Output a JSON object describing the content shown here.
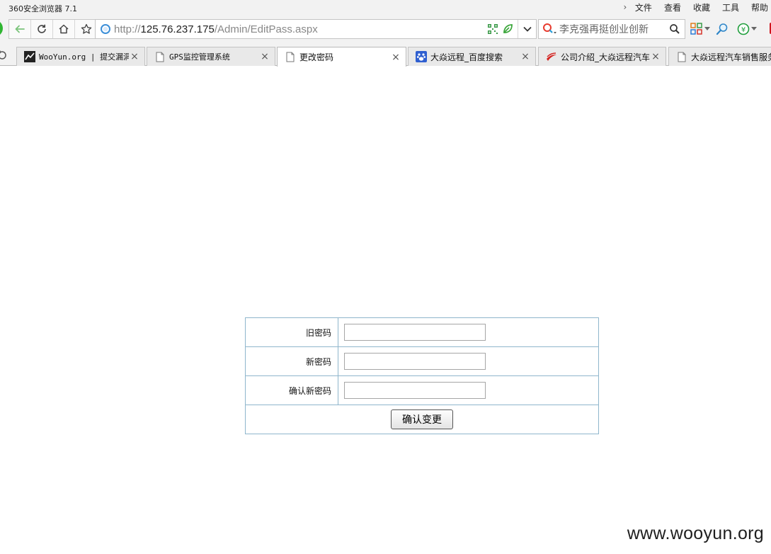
{
  "browser": {
    "title": "360安全浏览器 7.1",
    "menu": [
      "文件",
      "查看",
      "收藏",
      "工具",
      "帮助"
    ]
  },
  "address": {
    "scheme": "http://",
    "host": "125.76.237.175",
    "path": "/Admin/EditPass.aspx"
  },
  "search": {
    "query": "李克强再挺创业创新"
  },
  "tabs": [
    {
      "title": "WooYun.org | 提交漏洞",
      "icon": "wooyun-icon",
      "active": false
    },
    {
      "title": "GPS监控管理系统",
      "icon": "page-icon",
      "active": false
    },
    {
      "title": "更改密码",
      "icon": "page-icon",
      "active": true
    },
    {
      "title": "大焱远程_百度搜索",
      "icon": "baidu-paw-icon",
      "active": false
    },
    {
      "title": "公司介绍_大焱远程汽车",
      "icon": "brand-swoosh-icon",
      "active": false
    },
    {
      "title": "大焱远程汽车销售服务",
      "icon": "page-icon",
      "active": false
    }
  ],
  "form": {
    "old_password_label": "旧密码",
    "new_password_label": "新密码",
    "confirm_password_label": "确认新密码",
    "old_password_value": "",
    "new_password_value": "",
    "confirm_password_value": "",
    "submit_label": "确认变更"
  },
  "watermark": "www.wooyun.org",
  "colors": {
    "chrome_bg": "#f2f2f2",
    "table_border": "#8fb6cc",
    "back_arrow": "#7bc47b",
    "accent_green": "#2fb531"
  }
}
